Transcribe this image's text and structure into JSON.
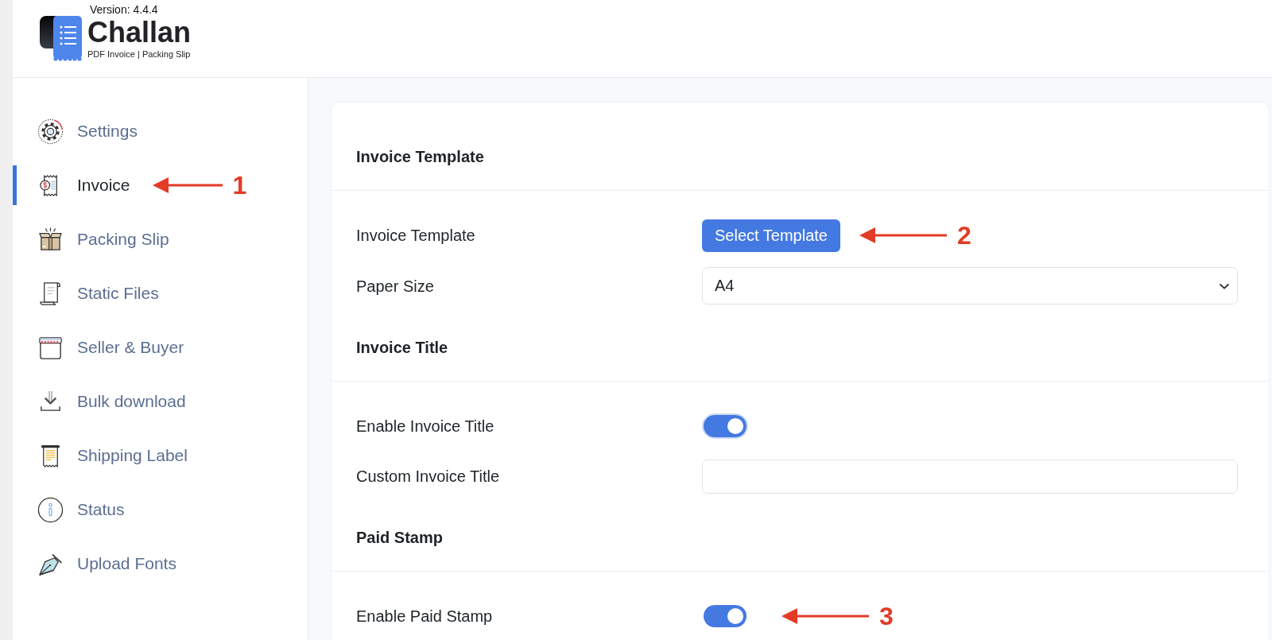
{
  "header": {
    "version": "Version: 4.4.4",
    "brand": "Challan",
    "tagline": "PDF Invoice | Packing Slip"
  },
  "sidebar": {
    "items": [
      {
        "label": "Settings",
        "selected": false
      },
      {
        "label": "Invoice",
        "selected": true,
        "annotation": "1"
      },
      {
        "label": "Packing Slip",
        "selected": false
      },
      {
        "label": "Static Files",
        "selected": false
      },
      {
        "label": "Seller & Buyer",
        "selected": false
      },
      {
        "label": "Bulk download",
        "selected": false
      },
      {
        "label": "Shipping Label",
        "selected": false
      },
      {
        "label": "Status",
        "selected": false
      },
      {
        "label": "Upload Fonts",
        "selected": false
      }
    ]
  },
  "card": {
    "sections": [
      {
        "heading": "Invoice Template",
        "fields": [
          {
            "kind": "button",
            "label": "Invoice Template",
            "button": "Select Template",
            "annotation": "2"
          },
          {
            "kind": "select",
            "label": "Paper Size",
            "value": "A4"
          }
        ]
      },
      {
        "heading": "Invoice Title",
        "fields": [
          {
            "kind": "toggle",
            "label": "Enable Invoice Title",
            "on": true,
            "focused": true
          },
          {
            "kind": "text",
            "label": "Custom Invoice Title"
          }
        ]
      },
      {
        "heading": "Paid Stamp",
        "fields": [
          {
            "kind": "toggle",
            "label": "Enable Paid Stamp",
            "on": true,
            "focused": false,
            "annotation": "3"
          }
        ]
      }
    ]
  }
}
